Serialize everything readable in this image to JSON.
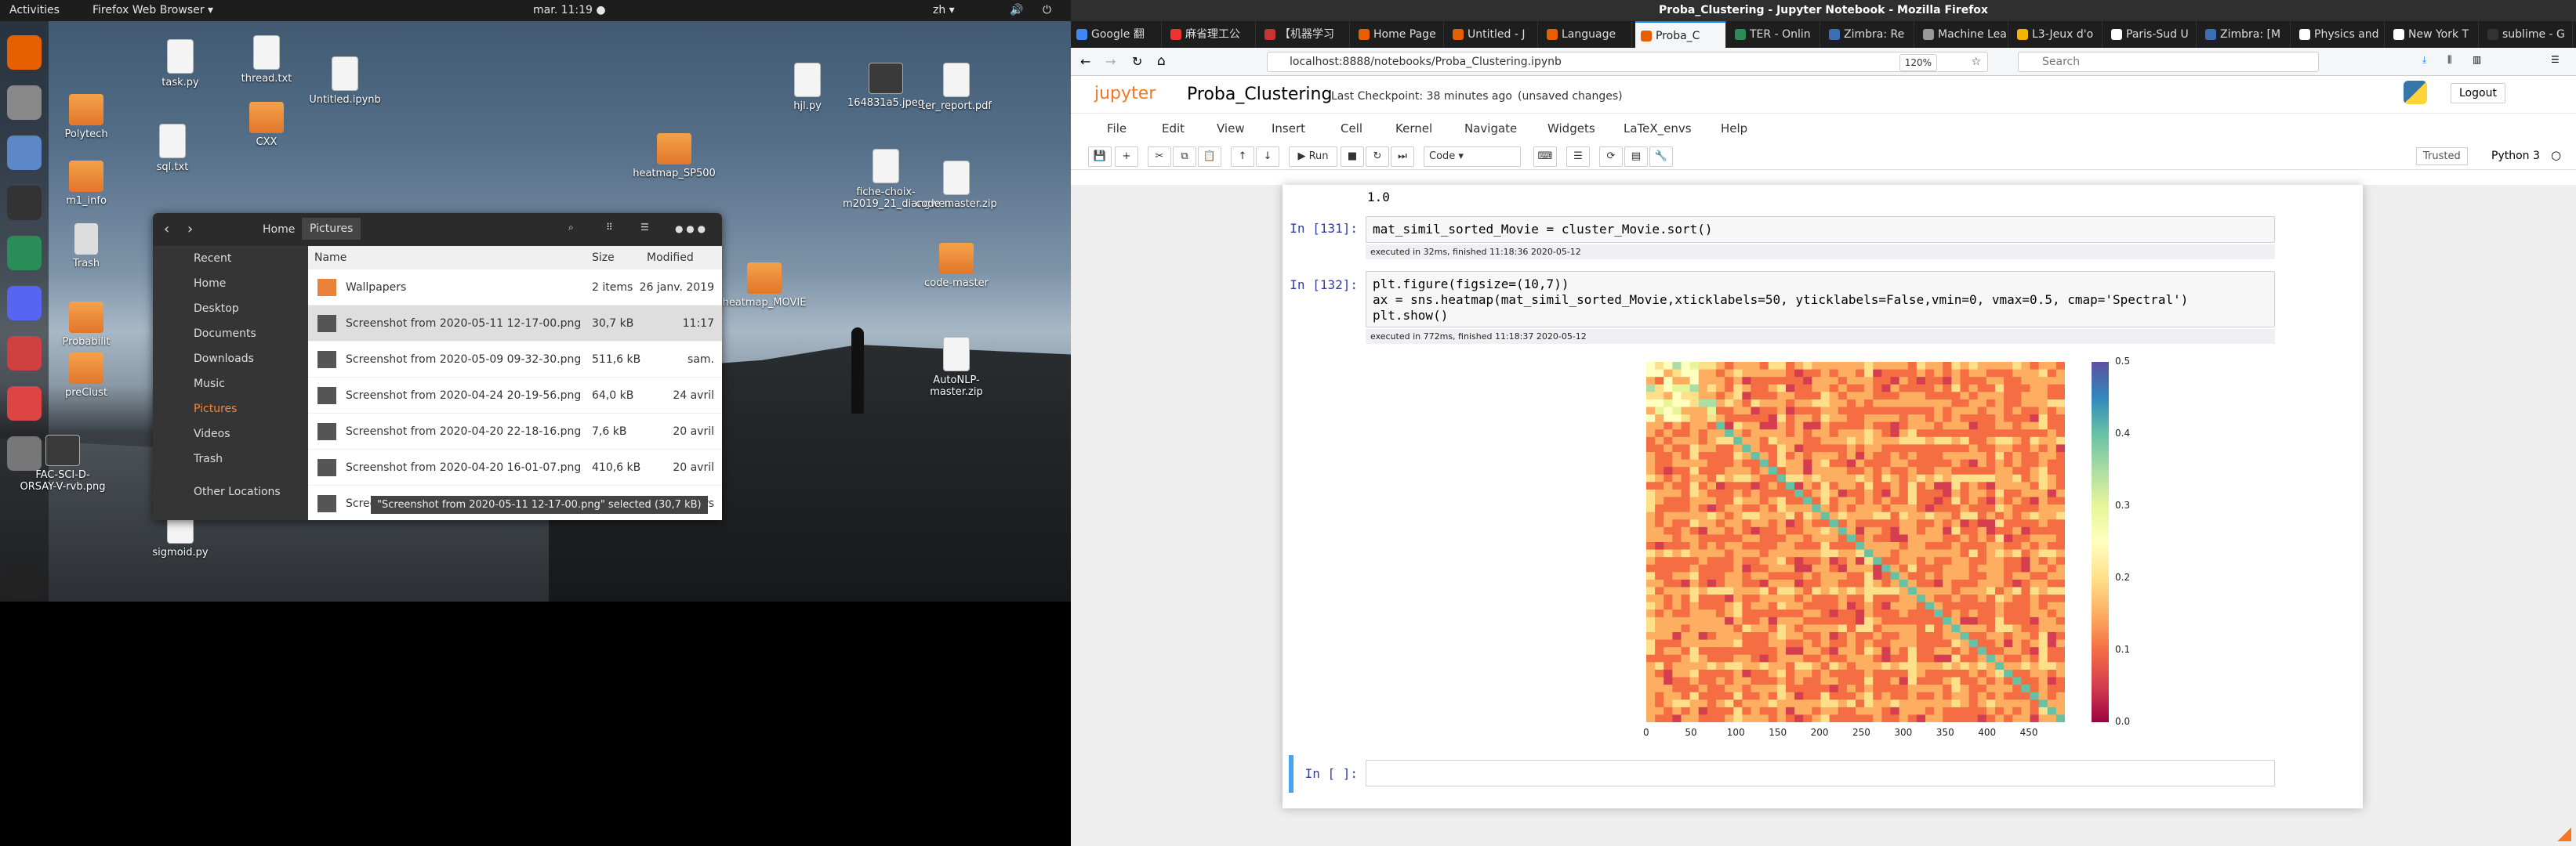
{
  "left_screen": {
    "topbar": {
      "activities": "Activities",
      "app": "Firefox Web Browser ▾",
      "clock": "mar. 11:19 ●",
      "lang": "zh ▾"
    },
    "dock": [
      "firefox-icon",
      "files-icon",
      "software-icon",
      "terminal-icon",
      "globe-icon",
      "discord-icon",
      "editor-icon",
      "settings-icon",
      "magnifier-icon",
      "apps-grid-icon"
    ],
    "desktop_icons": [
      {
        "label": "Polytech",
        "kind": "folder"
      },
      {
        "label": "task.py",
        "kind": "file"
      },
      {
        "label": "thread.txt",
        "kind": "file"
      },
      {
        "label": "Untitled.ipynb",
        "kind": "file"
      },
      {
        "label": "sql.txt",
        "kind": "file"
      },
      {
        "label": "CXX",
        "kind": "folder"
      },
      {
        "label": "m1_info",
        "kind": "folder"
      },
      {
        "label": "Trash",
        "kind": "trash"
      },
      {
        "label": "Probabilit",
        "kind": "folder"
      },
      {
        "label": "preClust",
        "kind": "folder"
      },
      {
        "label": "FAC-SCI-D-ORSAY-V-rvb.png",
        "kind": "image"
      },
      {
        "label": "sigmoid.py",
        "kind": "file"
      },
      {
        "label": "heatmap_SP500",
        "kind": "folder"
      },
      {
        "label": "heatmap_MOVIE",
        "kind": "folder"
      },
      {
        "label": "hjl.py",
        "kind": "file"
      },
      {
        "label": "164831a5.jpeg",
        "kind": "image"
      },
      {
        "label": "ter_report.pdf",
        "kind": "file"
      },
      {
        "label": "fiche-choix-m2019_21_diangwen...",
        "kind": "file"
      },
      {
        "label": "code-master.zip",
        "kind": "file"
      },
      {
        "label": "code-master",
        "kind": "folder"
      },
      {
        "label": "AutoNLP-master.zip",
        "kind": "file"
      }
    ],
    "file_manager": {
      "breadcrumb": [
        "Home",
        "Pictures"
      ],
      "sidebar": [
        "Recent",
        "Home",
        "Desktop",
        "Documents",
        "Downloads",
        "Music",
        "Pictures",
        "Videos",
        "Trash",
        "Other Locations"
      ],
      "columns": [
        "Name",
        "Size",
        "Modified"
      ],
      "rows": [
        {
          "name": "Wallpapers",
          "size": "2 items",
          "modified": "26 janv. 2019"
        },
        {
          "name": "Screenshot from 2020-05-11 12-17-00.png",
          "size": "30,7 kB",
          "modified": "11:17"
        },
        {
          "name": "Screenshot from 2020-05-09 09-32-30.png",
          "size": "511,6 kB",
          "modified": "sam."
        },
        {
          "name": "Screenshot from 2020-04-24 20-19-56.png",
          "size": "64,0 kB",
          "modified": "24 avril"
        },
        {
          "name": "Screenshot from 2020-04-20 22-18-16.png",
          "size": "7,6 kB",
          "modified": "20 avril"
        },
        {
          "name": "Screenshot from 2020-04-20 16-01-07.png",
          "size": "410,6 kB",
          "modified": "20 avril"
        },
        {
          "name": "Screenshot from 2020-03-21 23-01-06.png",
          "size": "174,9 kB",
          "modified": "21 mars"
        }
      ],
      "status": "\"Screenshot from 2020-05-11 12-17-00.png\" selected (30,7 kB)"
    }
  },
  "browser": {
    "window_title": "Proba_Clustering - Jupyter Notebook - Mozilla Firefox",
    "tabs": [
      "Google 翻",
      "麻省理工公",
      "【机器学习",
      "Home Page",
      "Untitled - J",
      "Language",
      "Proba_C",
      "TER - Onlin",
      "Zimbra: Re",
      "Machine Lea",
      "L3-Jeux d'o",
      "Paris-Sud U",
      "Zimbra: [M",
      "Physics and",
      "New York T",
      "sublime - G"
    ],
    "active_tab": 6,
    "url": "localhost:8888/notebooks/Proba_Clustering.ipynb",
    "zoom": "120%",
    "search_placeholder": "Search"
  },
  "jupyter": {
    "logo": "jupyter",
    "notebook_name": "Proba_Clustering",
    "checkpoint": "Last Checkpoint: 38 minutes ago",
    "unsaved": "(unsaved changes)",
    "logout": "Logout",
    "menu": [
      "File",
      "Edit",
      "View",
      "Insert",
      "Cell",
      "Kernel",
      "Navigate",
      "Widgets",
      "LaTeX_envs",
      "Help"
    ],
    "trusted": "Trusted",
    "kernel": "Python 3",
    "cell_type": "Code",
    "run_label": "Run",
    "output_prev": "1.0",
    "cells": [
      {
        "prompt": "In [131]:",
        "code": "mat_simil_sorted_Movie = cluster_Movie.sort()",
        "exec": "executed in 32ms, finished 11:18:36 2020-05-12"
      },
      {
        "prompt": "In [132]:",
        "code_lines": [
          "plt.figure(figsize=(10,7))",
          "ax = sns.heatmap(mat_simil_sorted_Movie,xticklabels=50, yticklabels=False,vmin=0, vmax=0.5, cmap='Spectral')",
          "plt.show()"
        ],
        "exec": "executed in 772ms, finished 11:18:37 2020-05-12"
      },
      {
        "prompt": "In [ ]:",
        "code": ""
      }
    ]
  },
  "chart_data": {
    "type": "heatmap",
    "xticks": [
      "0",
      "50",
      "100",
      "150",
      "200",
      "250",
      "300",
      "350",
      "400",
      "450"
    ],
    "colorbar_ticks": [
      "0.5",
      "0.4",
      "0.3",
      "0.2",
      "0.1",
      "0.0"
    ],
    "vmin": 0,
    "vmax": 0.5,
    "cmap": "Spectral"
  }
}
